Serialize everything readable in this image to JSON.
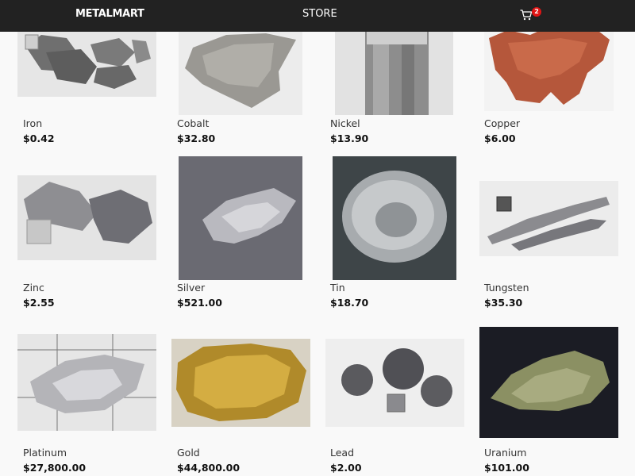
{
  "header": {
    "brand": "METALMART",
    "store_link": "STORE",
    "cart_count": "2"
  },
  "products": [
    {
      "name": "Iron",
      "price": "$0.42"
    },
    {
      "name": "Cobalt",
      "price": "$32.80"
    },
    {
      "name": "Nickel",
      "price": "$13.90"
    },
    {
      "name": "Copper",
      "price": "$6.00"
    },
    {
      "name": "Zinc",
      "price": "$2.55"
    },
    {
      "name": "Silver",
      "price": "$521.00"
    },
    {
      "name": "Tin",
      "price": "$18.70"
    },
    {
      "name": "Tungsten",
      "price": "$35.30"
    },
    {
      "name": "Platinum",
      "price": "$27,800.00"
    },
    {
      "name": "Gold",
      "price": "$44,800.00"
    },
    {
      "name": "Lead",
      "price": "$2.00"
    },
    {
      "name": "Uranium",
      "price": "$101.00"
    }
  ],
  "colors": {
    "navbar": "#222222",
    "background": "#f9f9f9",
    "badge": "#e01515"
  }
}
